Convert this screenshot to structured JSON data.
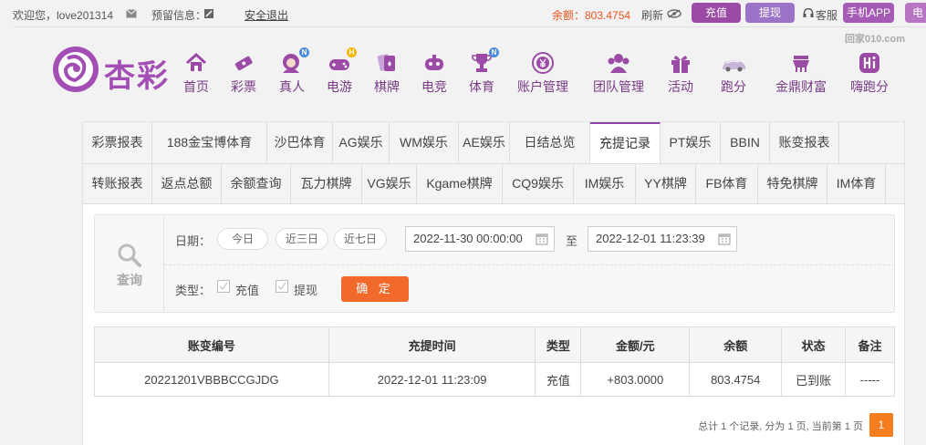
{
  "topbar": {
    "welcome": "欢迎您，love201314",
    "reserved_info": "预留信息：",
    "logout": "安全退出",
    "balance_label": "余额：803.4754",
    "refresh": "刷新",
    "deposit": "充值",
    "withdraw": "提现",
    "service": "客服",
    "mobile_app": "手机APP",
    "computer": "电",
    "watermark": "回家010.com"
  },
  "logo": {
    "text": "杏彩"
  },
  "nav": [
    {
      "label": "首页",
      "icon": "home-icon"
    },
    {
      "label": "彩票",
      "icon": "ticket-icon"
    },
    {
      "label": "真人",
      "icon": "dealer-icon",
      "badge": "N"
    },
    {
      "label": "电游",
      "icon": "gamepad-icon",
      "badge": "H"
    },
    {
      "label": "棋牌",
      "icon": "cards-icon"
    },
    {
      "label": "电竞",
      "icon": "esports-icon"
    },
    {
      "label": "体育",
      "icon": "trophy-icon",
      "badge": "N"
    },
    {
      "label": "账户管理",
      "icon": "yen-icon"
    },
    {
      "label": "团队管理",
      "icon": "team-icon"
    },
    {
      "label": "活动",
      "icon": "gift-icon"
    },
    {
      "label": "跑分",
      "icon": "car-icon"
    },
    {
      "label": "金鼎财富",
      "icon": "ding-icon"
    },
    {
      "label": "嗨跑分",
      "icon": "hi-icon"
    }
  ],
  "tabs_row1": [
    "彩票报表",
    "188金宝博体育",
    "沙巴体育",
    "AG娱乐",
    "WM娱乐",
    "AE娱乐",
    "日结总览",
    "充提记录",
    "PT娱乐",
    "BBIN",
    "账变报表"
  ],
  "tabs_row2": [
    "转账报表",
    "返点总额",
    "余额查询",
    "瓦力棋牌",
    "VG娱乐",
    "Kgame棋牌",
    "CQ9娱乐",
    "IM娱乐",
    "YY棋牌",
    "FB体育",
    "特免棋牌",
    "IM体育"
  ],
  "active_tab": "充提记录",
  "filter": {
    "query_label": "查询",
    "date_label": "日期：",
    "chips": [
      "今日",
      "近三日",
      "近七日"
    ],
    "start_date": "2022-11-30 00:00:00",
    "to": "至",
    "end_date": "2022-12-01 11:23:39",
    "type_label": "类型：",
    "type_deposit": "充值",
    "type_withdraw": "提现",
    "confirm": "确 定"
  },
  "table": {
    "headers": [
      "账变编号",
      "充提时间",
      "类型",
      "金额/元",
      "余额",
      "状态",
      "备注"
    ],
    "rows": [
      [
        "20221201VBBBCCGJDG",
        "2022-12-01 11:23:09",
        "充值",
        "+803.0000",
        "803.4754",
        "已到账",
        "-----"
      ]
    ]
  },
  "pager": {
    "summary": "总计 1 个记录, 分为 1 页, 当前第 1 页",
    "current": "1"
  },
  "colors": {
    "brand": "#8e44ad",
    "accent": "#f26a2a",
    "amount": "#e02020",
    "status_ok": "#2aa02a"
  }
}
